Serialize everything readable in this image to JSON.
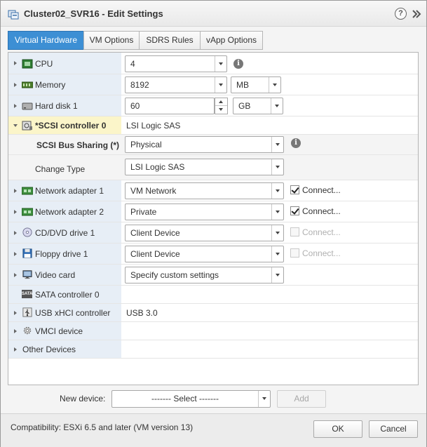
{
  "window": {
    "title": "Cluster02_SVR16 - Edit Settings",
    "help_label": "?",
    "expand_label": "»"
  },
  "tabs": [
    {
      "label": "Virtual Hardware",
      "active": true
    },
    {
      "label": "VM Options",
      "active": false
    },
    {
      "label": "SDRS Rules",
      "active": false
    },
    {
      "label": "vApp Options",
      "active": false
    }
  ],
  "hardware": {
    "cpu": {
      "label": "CPU",
      "value": "4",
      "icon": "cpu-icon"
    },
    "memory": {
      "label": "Memory",
      "value": "8192",
      "unit": "MB",
      "icon": "memory-icon"
    },
    "hard_disk": {
      "label": "Hard disk 1",
      "value": "60",
      "unit": "GB",
      "icon": "hard-disk-icon"
    },
    "scsi": {
      "label": "*SCSI controller 0",
      "value": "LSI Logic SAS",
      "icon": "scsi-controller-icon",
      "bus_sharing_label": "SCSI Bus Sharing (*)",
      "bus_sharing_value": "Physical",
      "change_type_label": "Change Type",
      "change_type_value": "LSI Logic SAS"
    },
    "net1": {
      "label": "Network adapter 1",
      "value": "VM Network",
      "connect_label": "Connect...",
      "connected": true,
      "icon": "network-adapter-icon"
    },
    "net2": {
      "label": "Network adapter 2",
      "value": "Private",
      "connect_label": "Connect...",
      "connected": true,
      "icon": "network-adapter-icon"
    },
    "cd": {
      "label": "CD/DVD drive 1",
      "value": "Client Device",
      "connect_label": "Connect...",
      "connected": false,
      "icon": "cd-dvd-icon"
    },
    "floppy": {
      "label": "Floppy drive 1",
      "value": "Client Device",
      "connect_label": "Connect...",
      "connected": false,
      "icon": "floppy-icon"
    },
    "video": {
      "label": "Video card",
      "value": "Specify custom settings",
      "icon": "video-card-icon"
    },
    "sata": {
      "label": "SATA controller 0",
      "icon_text": "SATA",
      "icon": "sata-controller-icon"
    },
    "usb": {
      "label": "USB xHCI controller",
      "value": "USB 3.0",
      "icon": "usb-icon"
    },
    "vmci": {
      "label": "VMCI device",
      "icon": "vmci-gear-icon"
    },
    "other": {
      "label": "Other Devices"
    }
  },
  "info_icon_glyph": "i",
  "new_device": {
    "label": "New device:",
    "select_value": "------- Select -------",
    "add_label": "Add"
  },
  "footer": {
    "compatibility": "Compatibility: ESXi 6.5 and later (VM version 13)",
    "ok_label": "OK",
    "cancel_label": "Cancel"
  },
  "colors": {
    "accent": "#3d8fd4",
    "left_column": "#e7eef6",
    "highlight_row": "#fbf5c9"
  }
}
